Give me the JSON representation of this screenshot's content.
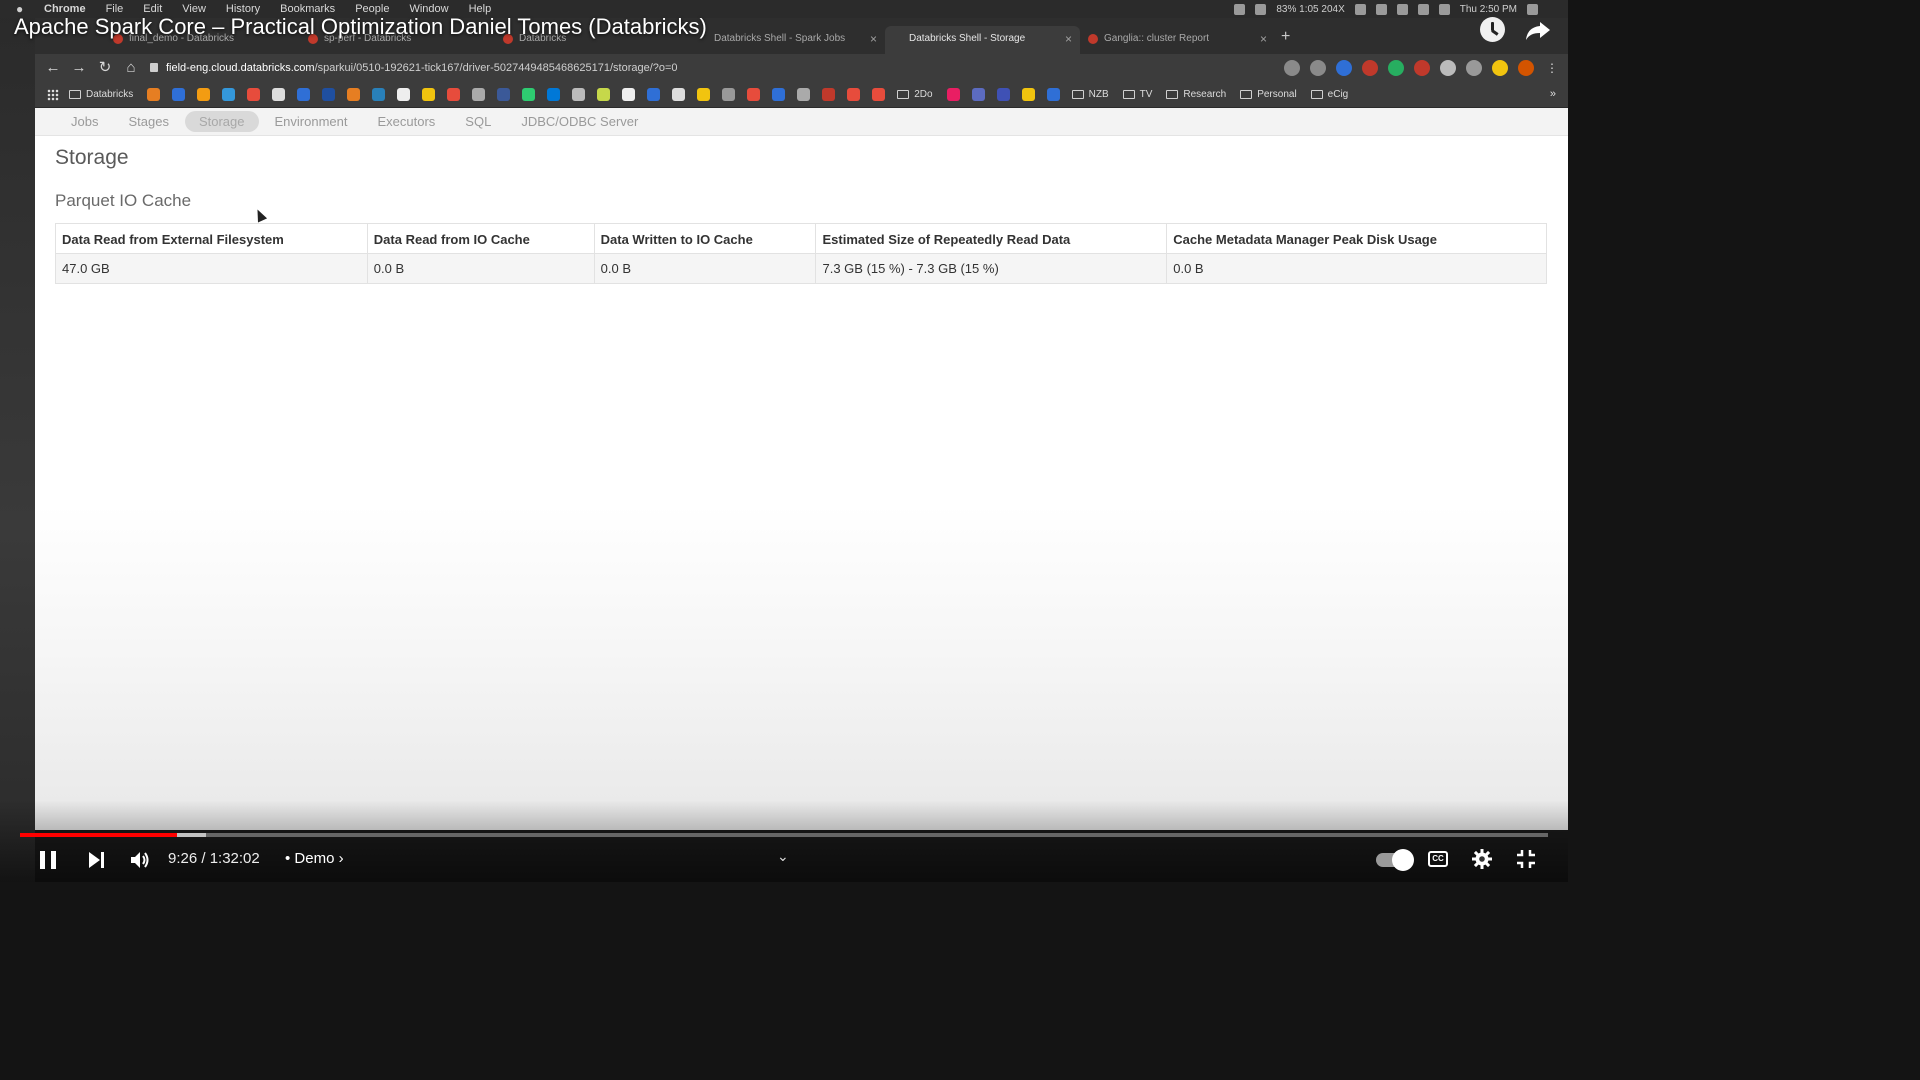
{
  "menubar": {
    "items": [
      "Chrome",
      "File",
      "Edit",
      "View",
      "History",
      "Bookmarks",
      "People",
      "Window",
      "Help"
    ],
    "status_text": "83% 1:05 204X",
    "clock": "Thu 2:50 PM"
  },
  "tabs": [
    {
      "label": "final_demo - Databricks",
      "active": false
    },
    {
      "label": "sp-perf - Databricks",
      "active": false
    },
    {
      "label": "Databricks",
      "active": false
    },
    {
      "label": "Databricks Shell - Spark Jobs",
      "active": false
    },
    {
      "label": "Databricks Shell - Storage",
      "active": true
    },
    {
      "label": "Ganglia:: cluster Report",
      "active": false
    }
  ],
  "video": {
    "title": "Apache Spark Core – Practical Optimization Daniel Tomes (Databricks)",
    "current_time": "9:26",
    "duration": "1:32:02",
    "time_display": "9:26 / 1:32:02",
    "chapter": "• Demo ›",
    "progress_fraction": 0.1026,
    "buffered_fraction": 0.1215
  },
  "address_bar": {
    "host": "field-eng.cloud.databricks.com",
    "path": "/sparkui/0510-192621-tick167/driver-5027449485468625171/storage/?o=0"
  },
  "bookmarks": {
    "first": "Databricks",
    "folders": [
      "2Do",
      "NZB",
      "TV",
      "Research",
      "Personal",
      "eCig"
    ],
    "more": "»"
  },
  "spark_ui": {
    "nav": [
      "Jobs",
      "Stages",
      "Storage",
      "Environment",
      "Executors",
      "SQL",
      "JDBC/ODBC Server"
    ],
    "active_tab": "Storage",
    "page_title": "Storage",
    "section_title": "Parquet IO Cache",
    "table": {
      "headers": [
        "Data Read from External Filesystem",
        "Data Read from IO Cache",
        "Data Written to IO Cache",
        "Estimated Size of Repeatedly Read Data",
        "Cache Metadata Manager Peak Disk Usage"
      ],
      "row": [
        "47.0 GB",
        "0.0 B",
        "0.0 B",
        "7.3 GB (15 %) - 7.3 GB (15 %)",
        "0.0 B"
      ]
    }
  },
  "colors": {
    "youtube_red": "#ff0000",
    "spark_nav_bg": "#f3f3f3",
    "chrome_dark": "#3c3c3c"
  }
}
